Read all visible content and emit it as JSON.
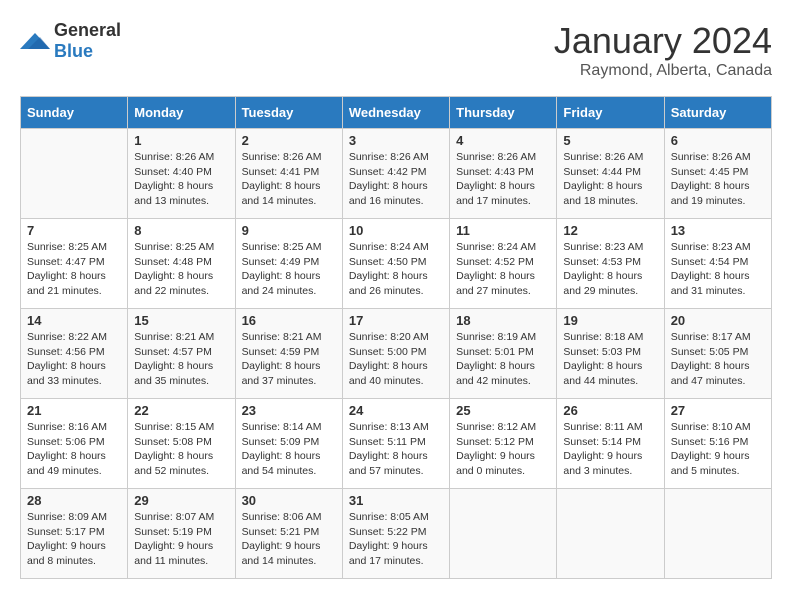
{
  "header": {
    "logo_general": "General",
    "logo_blue": "Blue",
    "month": "January 2024",
    "location": "Raymond, Alberta, Canada"
  },
  "weekdays": [
    "Sunday",
    "Monday",
    "Tuesday",
    "Wednesday",
    "Thursday",
    "Friday",
    "Saturday"
  ],
  "weeks": [
    [
      {
        "day": "",
        "info": ""
      },
      {
        "day": "1",
        "info": "Sunrise: 8:26 AM\nSunset: 4:40 PM\nDaylight: 8 hours\nand 13 minutes."
      },
      {
        "day": "2",
        "info": "Sunrise: 8:26 AM\nSunset: 4:41 PM\nDaylight: 8 hours\nand 14 minutes."
      },
      {
        "day": "3",
        "info": "Sunrise: 8:26 AM\nSunset: 4:42 PM\nDaylight: 8 hours\nand 16 minutes."
      },
      {
        "day": "4",
        "info": "Sunrise: 8:26 AM\nSunset: 4:43 PM\nDaylight: 8 hours\nand 17 minutes."
      },
      {
        "day": "5",
        "info": "Sunrise: 8:26 AM\nSunset: 4:44 PM\nDaylight: 8 hours\nand 18 minutes."
      },
      {
        "day": "6",
        "info": "Sunrise: 8:26 AM\nSunset: 4:45 PM\nDaylight: 8 hours\nand 19 minutes."
      }
    ],
    [
      {
        "day": "7",
        "info": "Sunrise: 8:25 AM\nSunset: 4:47 PM\nDaylight: 8 hours\nand 21 minutes."
      },
      {
        "day": "8",
        "info": "Sunrise: 8:25 AM\nSunset: 4:48 PM\nDaylight: 8 hours\nand 22 minutes."
      },
      {
        "day": "9",
        "info": "Sunrise: 8:25 AM\nSunset: 4:49 PM\nDaylight: 8 hours\nand 24 minutes."
      },
      {
        "day": "10",
        "info": "Sunrise: 8:24 AM\nSunset: 4:50 PM\nDaylight: 8 hours\nand 26 minutes."
      },
      {
        "day": "11",
        "info": "Sunrise: 8:24 AM\nSunset: 4:52 PM\nDaylight: 8 hours\nand 27 minutes."
      },
      {
        "day": "12",
        "info": "Sunrise: 8:23 AM\nSunset: 4:53 PM\nDaylight: 8 hours\nand 29 minutes."
      },
      {
        "day": "13",
        "info": "Sunrise: 8:23 AM\nSunset: 4:54 PM\nDaylight: 8 hours\nand 31 minutes."
      }
    ],
    [
      {
        "day": "14",
        "info": "Sunrise: 8:22 AM\nSunset: 4:56 PM\nDaylight: 8 hours\nand 33 minutes."
      },
      {
        "day": "15",
        "info": "Sunrise: 8:21 AM\nSunset: 4:57 PM\nDaylight: 8 hours\nand 35 minutes."
      },
      {
        "day": "16",
        "info": "Sunrise: 8:21 AM\nSunset: 4:59 PM\nDaylight: 8 hours\nand 37 minutes."
      },
      {
        "day": "17",
        "info": "Sunrise: 8:20 AM\nSunset: 5:00 PM\nDaylight: 8 hours\nand 40 minutes."
      },
      {
        "day": "18",
        "info": "Sunrise: 8:19 AM\nSunset: 5:01 PM\nDaylight: 8 hours\nand 42 minutes."
      },
      {
        "day": "19",
        "info": "Sunrise: 8:18 AM\nSunset: 5:03 PM\nDaylight: 8 hours\nand 44 minutes."
      },
      {
        "day": "20",
        "info": "Sunrise: 8:17 AM\nSunset: 5:05 PM\nDaylight: 8 hours\nand 47 minutes."
      }
    ],
    [
      {
        "day": "21",
        "info": "Sunrise: 8:16 AM\nSunset: 5:06 PM\nDaylight: 8 hours\nand 49 minutes."
      },
      {
        "day": "22",
        "info": "Sunrise: 8:15 AM\nSunset: 5:08 PM\nDaylight: 8 hours\nand 52 minutes."
      },
      {
        "day": "23",
        "info": "Sunrise: 8:14 AM\nSunset: 5:09 PM\nDaylight: 8 hours\nand 54 minutes."
      },
      {
        "day": "24",
        "info": "Sunrise: 8:13 AM\nSunset: 5:11 PM\nDaylight: 8 hours\nand 57 minutes."
      },
      {
        "day": "25",
        "info": "Sunrise: 8:12 AM\nSunset: 5:12 PM\nDaylight: 9 hours\nand 0 minutes."
      },
      {
        "day": "26",
        "info": "Sunrise: 8:11 AM\nSunset: 5:14 PM\nDaylight: 9 hours\nand 3 minutes."
      },
      {
        "day": "27",
        "info": "Sunrise: 8:10 AM\nSunset: 5:16 PM\nDaylight: 9 hours\nand 5 minutes."
      }
    ],
    [
      {
        "day": "28",
        "info": "Sunrise: 8:09 AM\nSunset: 5:17 PM\nDaylight: 9 hours\nand 8 minutes."
      },
      {
        "day": "29",
        "info": "Sunrise: 8:07 AM\nSunset: 5:19 PM\nDaylight: 9 hours\nand 11 minutes."
      },
      {
        "day": "30",
        "info": "Sunrise: 8:06 AM\nSunset: 5:21 PM\nDaylight: 9 hours\nand 14 minutes."
      },
      {
        "day": "31",
        "info": "Sunrise: 8:05 AM\nSunset: 5:22 PM\nDaylight: 9 hours\nand 17 minutes."
      },
      {
        "day": "",
        "info": ""
      },
      {
        "day": "",
        "info": ""
      },
      {
        "day": "",
        "info": ""
      }
    ]
  ]
}
